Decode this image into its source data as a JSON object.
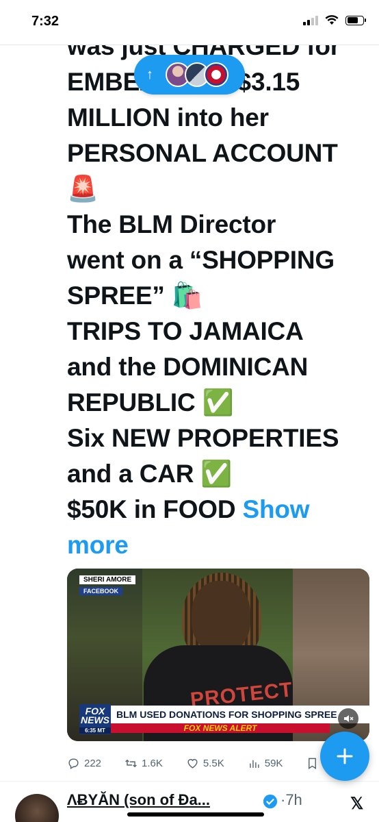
{
  "status_bar": {
    "time": "7:32"
  },
  "tweet": {
    "lines": [
      "was just CHARGED for",
      "EMBEZZLING $3.15",
      "MILLION into her",
      "PERSONAL ACCOUNT",
      "🚨",
      "The BLM Director",
      "went on a “SHOPPING",
      "SPREE” 🛍️",
      "TRIPS TO JAMAICA",
      "and the DOMINICAN",
      "REPUBLIC ✅",
      "Six NEW PROPERTIES",
      "and a CAR ✅",
      "$50K in FOOD"
    ],
    "show_more": "Show more"
  },
  "new_posts_pill": {
    "arrow": "↑"
  },
  "media": {
    "source_name": "SHERI AMORE",
    "source_site": "FACEBOOK",
    "shirt_text": "PROTECT",
    "network": "FOX NEWS",
    "time": "6:35 MT",
    "headline": "BLM USED DONATIONS FOR SHOPPING SPREE",
    "alert": "FOX NEWS ALERT"
  },
  "actions": {
    "replies": "222",
    "reposts": "1.6K",
    "likes": "5.5K",
    "views": "59K"
  },
  "next_tweet": {
    "name": "ΛɃYĂN (son of Đa...",
    "time": "·7h"
  },
  "colors": {
    "accent": "#1d9bf0",
    "text": "#0f1419",
    "muted": "#536471"
  }
}
